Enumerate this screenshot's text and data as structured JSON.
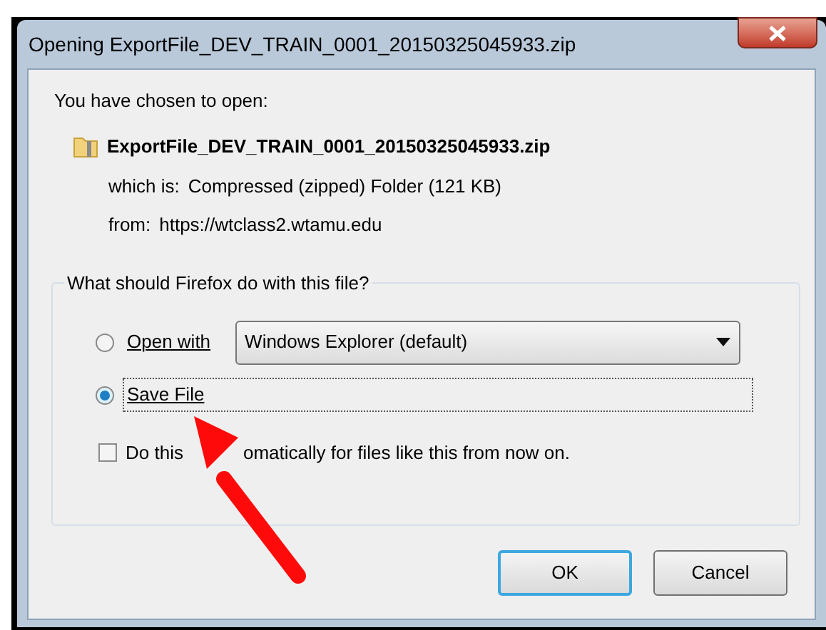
{
  "window": {
    "title": "Opening ExportFile_DEV_TRAIN_0001_20150325045933.zip"
  },
  "intro": "You have chosen to open:",
  "file": {
    "name": "ExportFile_DEV_TRAIN_0001_20150325045933.zip",
    "details": [
      {
        "label": "which is:",
        "value": "Compressed (zipped) Folder (121 KB)"
      },
      {
        "label": "from:",
        "value": "https://wtclass2.wtamu.edu"
      }
    ]
  },
  "group": {
    "legend": "What should Firefox do with this file?",
    "options": [
      {
        "label": "Open with",
        "selected": false,
        "focused": false,
        "app": "Windows Explorer (default)"
      },
      {
        "label": "Save File",
        "selected": true,
        "focused": true
      }
    ],
    "remember": {
      "label_parts": [
        "Do this",
        "omatically for files like this from now on."
      ],
      "checked": false
    }
  },
  "buttons": [
    {
      "label": "OK",
      "default": true
    },
    {
      "label": "Cancel",
      "default": false
    }
  ]
}
